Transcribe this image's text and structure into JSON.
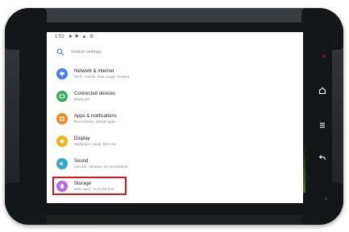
{
  "status_bar": {
    "time": "1:52",
    "icons": "■ ✱ ▲ ⚙"
  },
  "search": {
    "placeholder": "Search settings"
  },
  "settings_items": [
    {
      "title": "Network & internet",
      "subtitle": "Wi-Fi, mobile, data usage, hotspot",
      "color": "#4a7ff0",
      "icon": "wifi-icon"
    },
    {
      "title": "Connected devices",
      "subtitle": "Bluetooth",
      "color": "#3aa860",
      "icon": "devices-icon"
    },
    {
      "title": "Apps & notifications",
      "subtitle": "Permissions, default apps",
      "color": "#f08a1a",
      "icon": "apps-icon"
    },
    {
      "title": "Display",
      "subtitle": "Wallpaper, sleep, font size",
      "color": "#f0b21a",
      "icon": "display-icon"
    },
    {
      "title": "Sound",
      "subtitle": "Volume, vibration, Do Not Disturb",
      "color": "#36a7c6",
      "icon": "sound-icon"
    },
    {
      "title": "Storage",
      "subtitle": "49% used - 8.19 GB free",
      "color": "#b76be0",
      "icon": "storage-icon"
    }
  ],
  "highlighted_item": "Storage",
  "colors": {
    "highlight": "#e0141e",
    "bezel": "#141516",
    "shell": "#2a2c2e"
  }
}
